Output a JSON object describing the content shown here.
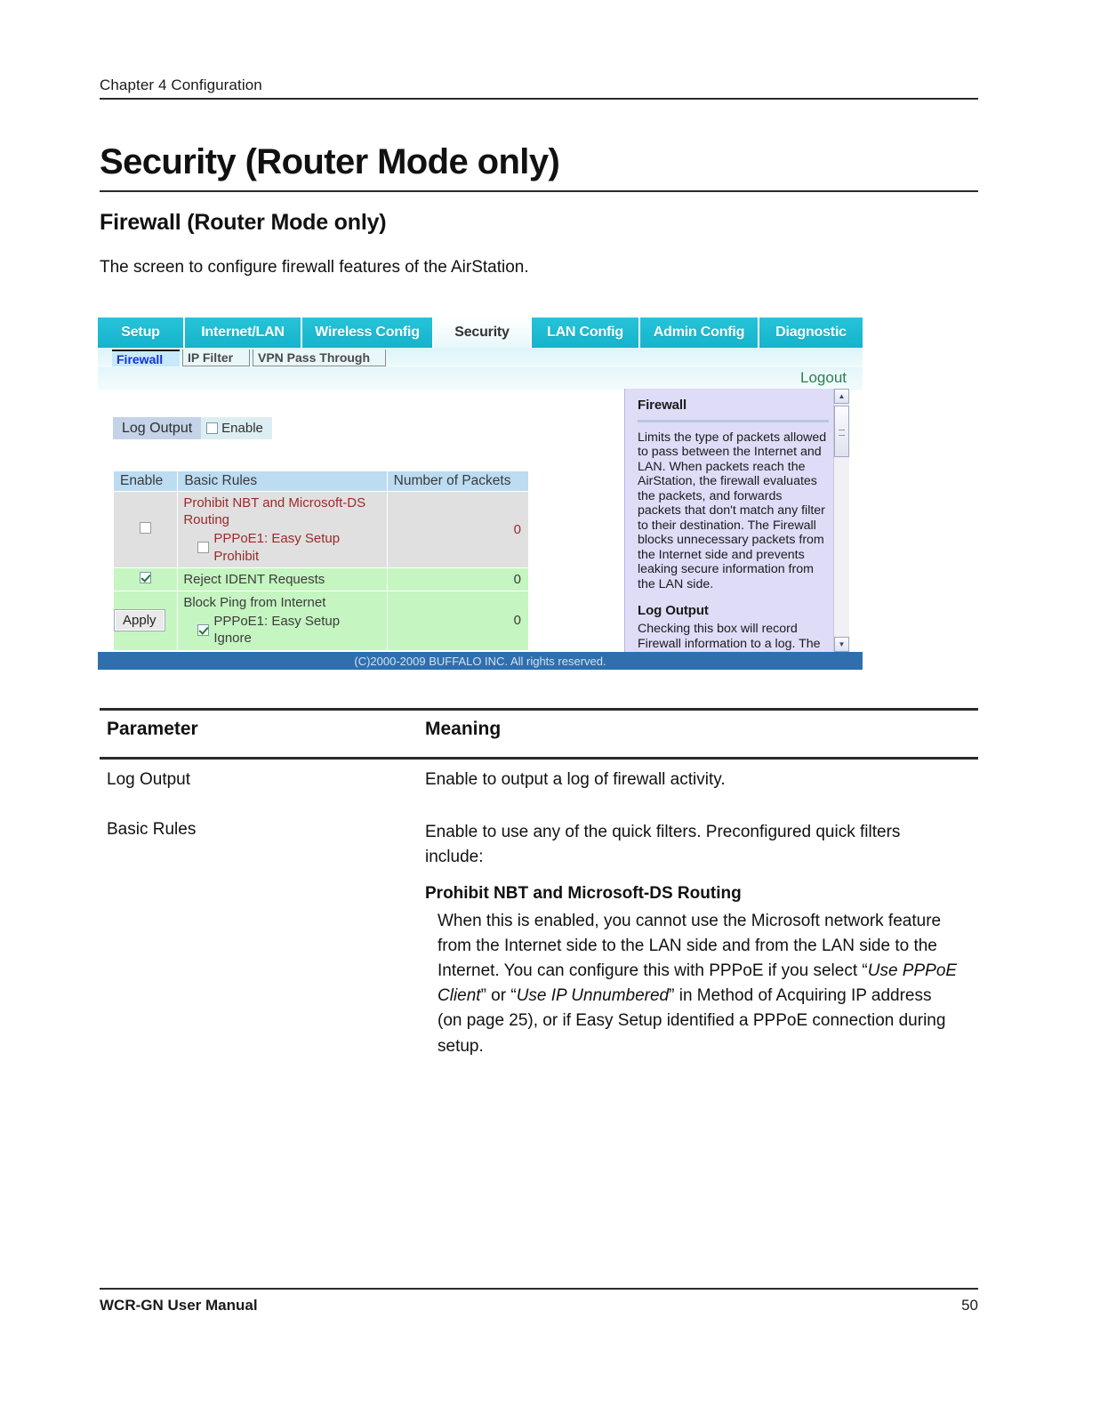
{
  "document": {
    "running_head": "Chapter 4  Configuration",
    "title": "Security (Router Mode only)",
    "subtitle": "Firewall (Router Mode only)",
    "intro": "The screen to configure firewall features of the AirStation.",
    "footer_left": "WCR-GN User Manual",
    "footer_page": "50"
  },
  "screenshot": {
    "tabs": [
      {
        "label": "Setup",
        "active": false
      },
      {
        "label": "Internet/LAN",
        "active": false
      },
      {
        "label": "Wireless Config",
        "active": false
      },
      {
        "label": "Security",
        "active": true
      },
      {
        "label": "LAN Config",
        "active": false
      },
      {
        "label": "Admin Config",
        "active": false
      },
      {
        "label": "Diagnostic",
        "active": false
      }
    ],
    "subtabs": [
      {
        "label": "Firewall",
        "active": true
      },
      {
        "label": "IP Filter",
        "active": false
      },
      {
        "label": "VPN Pass Through",
        "active": false
      }
    ],
    "logout_label": "Logout",
    "log_output": {
      "label": "Log Output",
      "checkbox_label": "Enable",
      "checked": false
    },
    "table": {
      "headers": [
        "Enable",
        "Basic Rules",
        "Number of Packets"
      ],
      "rows": [
        {
          "enabled": false,
          "rule": "Prohibit NBT and Microsoft-DS Routing",
          "sub_option": "PPPoE1: Easy Setup Prohibit",
          "sub_checked": false,
          "packets": "0"
        },
        {
          "enabled": true,
          "rule": "Reject IDENT Requests",
          "sub_option": "",
          "sub_checked": false,
          "packets": "0"
        },
        {
          "enabled": true,
          "rule": "Block Ping from Internet",
          "sub_option": "PPPoE1: Easy Setup Ignore",
          "sub_checked": true,
          "packets": "0"
        }
      ]
    },
    "apply_label": "Apply",
    "help": {
      "heading1": "Firewall",
      "body1": "Limits the type of packets allowed to pass between the Internet and LAN. When packets reach the AirStation, the firewall evaluates the packets, and forwards packets that don't match any filter to their destination. The Firewall blocks unnecessary packets from the Internet side and prevents leaking secure information from the LAN side.",
      "heading2": "Log Output",
      "body2": "Checking this box will record Firewall information to a log. The default setting is disabled."
    },
    "copyright": "(C)2000-2009 BUFFALO INC. All rights reserved."
  },
  "param_table": {
    "header_parameter": "Parameter",
    "header_meaning": "Meaning",
    "rows": [
      {
        "parameter": "Log Output",
        "meaning": "Enable to output a log of firewall activity."
      },
      {
        "parameter": "Basic Rules",
        "meaning": "Enable to use any of the quick filters. Preconfigured quick filters include:"
      }
    ],
    "sub_heading": "Prohibit NBT and Microsoft-DS Routing",
    "sub_body_pre": "When this is enabled, you cannot use the Microsoft network feature from the Internet side to the LAN side and from the LAN side to the Internet. You can configure this with PPPoE if you select “",
    "sub_body_italic1": "Use PPPoE Client",
    "sub_body_mid": "” or “",
    "sub_body_italic2": "Use IP Unnumbered",
    "sub_body_post": "” in Method of Acquiring IP address (on page 25), or if Easy Setup identified a PPPoE connection during setup."
  },
  "colors": {
    "tab_teal": "#14b4cc",
    "row_disabled": "#e0e0e0",
    "row_enabled": "#c5f5c0",
    "rule_text_disabled": "#9c2a2a",
    "help_panel": "#dedcf7",
    "copyright_bar": "#2f6fae",
    "logout_green": "#2f7f4f"
  }
}
